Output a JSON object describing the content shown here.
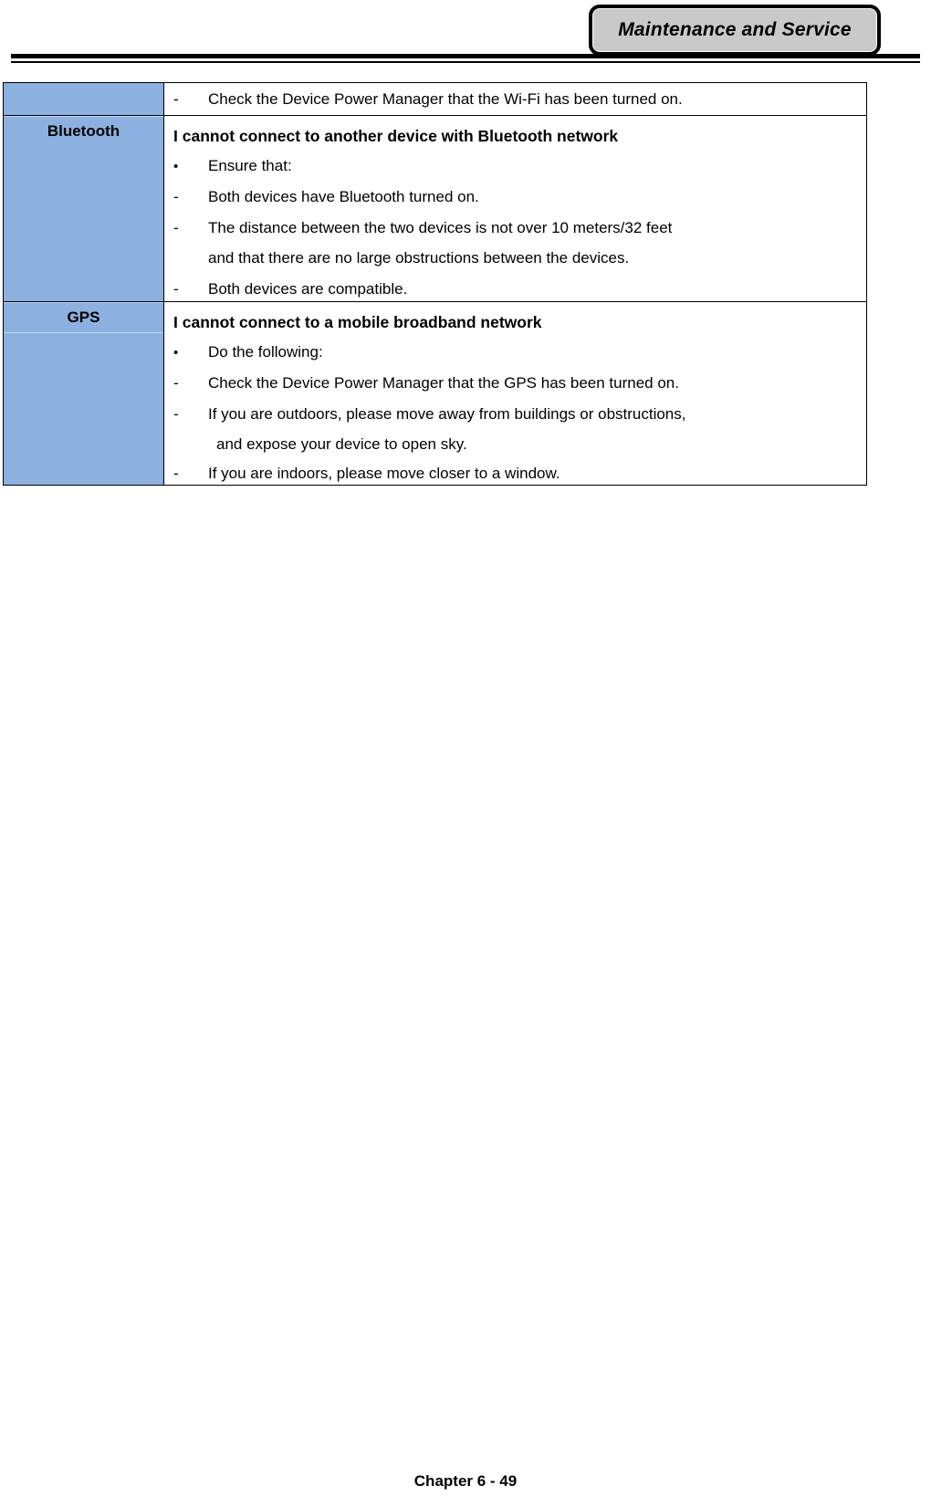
{
  "header": {
    "title": "Maintenance and Service",
    "box_fill": "#c9c9c9",
    "rule_color": "#000000"
  },
  "theme": {
    "label_cell_blue": "#8cb0e0",
    "label_divider": "#c6daf2",
    "text_color": "#000000",
    "page_background": "#ffffff"
  },
  "table": {
    "rows": [
      {
        "label": "",
        "label_visible": false,
        "heading": "",
        "items": [
          {
            "marker": "-",
            "text": "Check the Device Power Manager that the Wi-Fi has been turned on."
          }
        ]
      },
      {
        "label": "Bluetooth",
        "label_visible": true,
        "heading": "I cannot connect to another device with Bluetooth network",
        "items": [
          {
            "marker": "•",
            "text": "Ensure that:"
          },
          {
            "marker": "-",
            "text": "Both devices have Bluetooth turned on."
          },
          {
            "marker": "-",
            "text": "The distance between the two devices is not over 10 meters/32 feet",
            "continuation": "and that there are no large obstructions between the devices."
          },
          {
            "marker": "-",
            "text": "Both devices are compatible."
          }
        ]
      },
      {
        "label": "GPS",
        "label_visible": true,
        "heading": "I cannot connect to a mobile broadband network",
        "items": [
          {
            "marker": "•",
            "text": "Do the following:"
          },
          {
            "marker": "-",
            "text": "Check the Device Power Manager that the GPS has been turned on."
          },
          {
            "marker": "-",
            "text": "If you are outdoors, please move away from buildings or obstructions,",
            "continuation": "and expose your device to open sky."
          },
          {
            "marker": "-",
            "text": "If you are indoors, please move closer to a window."
          }
        ]
      }
    ]
  },
  "footer": {
    "page_label": "Chapter 6 - 49"
  }
}
